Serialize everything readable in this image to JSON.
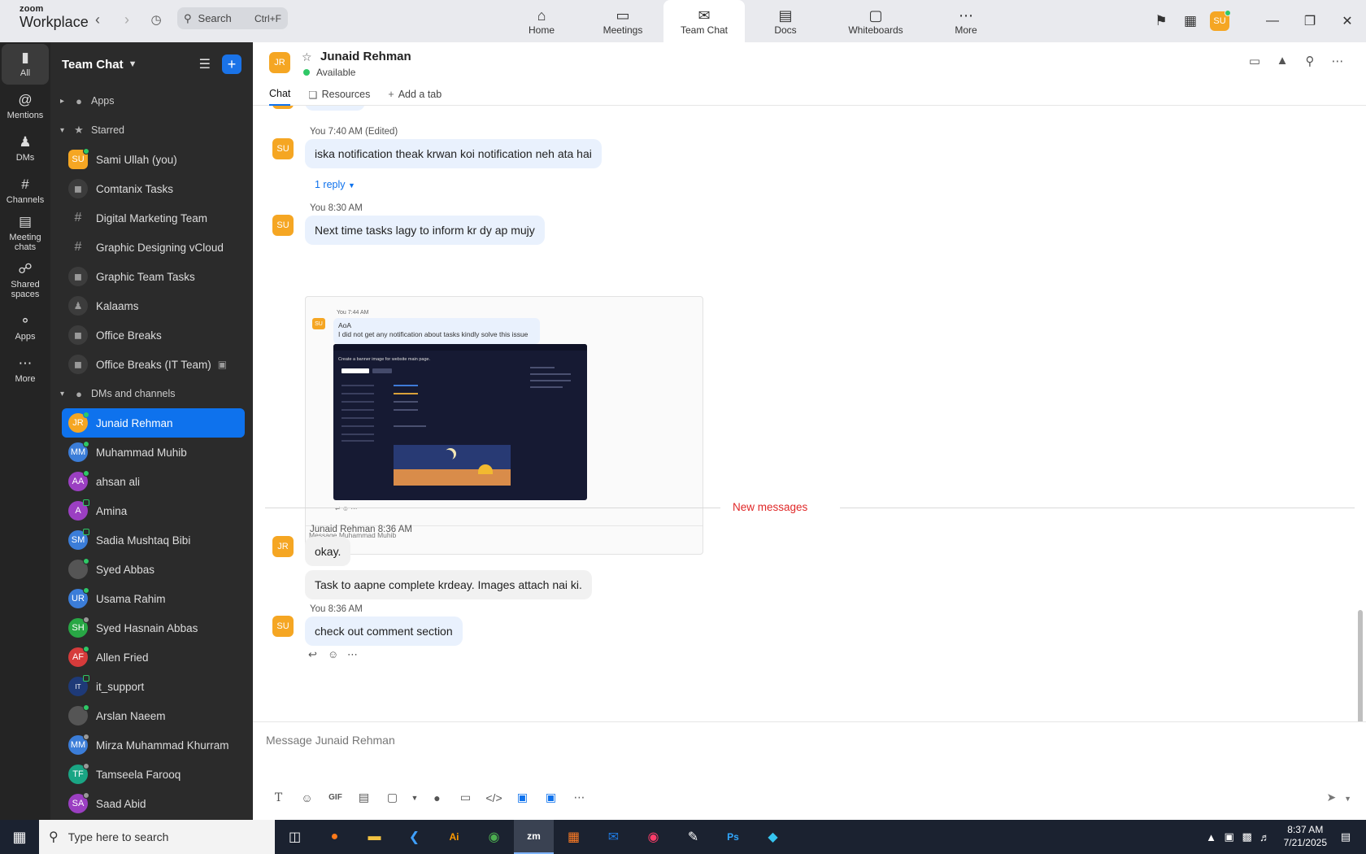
{
  "app": {
    "logo_small": "zoom",
    "logo_big": "Workplace",
    "search_placeholder": "Search",
    "search_shortcut": "Ctrl+F",
    "user_initials": "SU"
  },
  "top_nav": [
    {
      "label": "Home",
      "icon": "home-icon"
    },
    {
      "label": "Meetings",
      "icon": "video-icon"
    },
    {
      "label": "Team Chat",
      "icon": "chat-icon"
    },
    {
      "label": "Docs",
      "icon": "doc-icon"
    },
    {
      "label": "Whiteboards",
      "icon": "whiteboard-icon"
    },
    {
      "label": "More",
      "icon": "more-icon"
    }
  ],
  "rail": [
    {
      "label": "All",
      "icon": "chat-bubble-icon"
    },
    {
      "label": "Mentions",
      "icon": "at-icon"
    },
    {
      "label": "DMs",
      "icon": "people-icon"
    },
    {
      "label": "Channels",
      "icon": "hash-icon"
    },
    {
      "label": "Meeting chats",
      "icon": "calendar-icon"
    },
    {
      "label": "Shared spaces",
      "icon": "share-icon"
    },
    {
      "label": "Apps",
      "icon": "apps-icon"
    },
    {
      "label": "More",
      "icon": "ellipsis-icon"
    }
  ],
  "sidebar": {
    "title": "Team Chat",
    "sections": {
      "apps": "Apps",
      "starred": "Starred",
      "dms": "DMs and channels"
    },
    "starred": [
      {
        "label": "Sami Ullah (you)",
        "initials": "SU",
        "color": "#f5a623",
        "kind": "avatar"
      },
      {
        "label": "Comtanix Tasks",
        "kind": "lock"
      },
      {
        "label": "Digital Marketing Team",
        "kind": "hash"
      },
      {
        "label": "Graphic Designing vCloud",
        "kind": "hash"
      },
      {
        "label": "Graphic Team Tasks",
        "kind": "lock"
      },
      {
        "label": "Kalaams",
        "kind": "group"
      },
      {
        "label": "Office Breaks",
        "kind": "lock"
      },
      {
        "label": "Office Breaks (IT Team)",
        "kind": "lock"
      }
    ],
    "dms": [
      {
        "label": "Junaid Rehman",
        "initials": "JR",
        "color": "#f5a623"
      },
      {
        "label": "Muhammad Muhib",
        "initials": "MM",
        "color": "#3b7dd8"
      },
      {
        "label": "ahsan ali",
        "initials": "AA",
        "color": "#9b3fc2"
      },
      {
        "label": "Amina",
        "initials": "A",
        "color": "#9b3fc2"
      },
      {
        "label": "Sadia Mushtaq Bibi",
        "initials": "SM",
        "color": "#3b7dd8"
      },
      {
        "label": "Syed Abbas",
        "initials": "",
        "color": "#555555"
      },
      {
        "label": "Usama Rahim",
        "initials": "UR",
        "color": "#3b7dd8"
      },
      {
        "label": "Syed Hasnain Abbas",
        "initials": "SH",
        "color": "#28a745"
      },
      {
        "label": "Allen Fried",
        "initials": "AF",
        "color": "#d63b3b"
      },
      {
        "label": "it_support",
        "initials": "IT",
        "color": "#1e3a78"
      },
      {
        "label": "Arslan Naeem",
        "initials": "",
        "color": "#555555"
      },
      {
        "label": "Mirza Muhammad Khurram",
        "initials": "MM",
        "color": "#3b7dd8"
      },
      {
        "label": "Tamseela Farooq",
        "initials": "TF",
        "color": "#1aa584"
      },
      {
        "label": "Saad Abid",
        "initials": "SA",
        "color": "#9b3fc2"
      }
    ]
  },
  "chat": {
    "contact_initials": "JR",
    "contact_name": "Junaid Rehman",
    "status": "Available",
    "tabs": [
      "Chat",
      "Resources",
      "Add a tab"
    ],
    "messages": {
      "m1_meta": "You 7:40 AM (Edited)",
      "m1_text": "iska notification theak krwan koi notification neh ata hai",
      "m1_reply": "1 reply",
      "m2_meta": "You 8:30 AM",
      "m2_text": "Next time tasks lagy to inform kr dy ap mujy",
      "new_messages": "New messages",
      "m3_meta": "Junaid Rehman 8:36 AM",
      "m3_text": "okay.",
      "m4_text": "Task to aapne complete krdeay. Images attach nai ki.",
      "m5_meta": "You 8:36 AM",
      "m5_text": "check out comment section"
    },
    "embed": {
      "meta": "You 7:44 AM",
      "line1": "AoA",
      "line2": "I did not get any notification about tasks kindly solve this issue",
      "title": "Create a banner image for website main page.",
      "input_placeholder": "Message Muhammad Muhib"
    },
    "composer_placeholder": "Message Junaid Rehman",
    "composer_gif": "GIF"
  },
  "taskbar": {
    "search_placeholder": "Type here to search",
    "time": "8:37 AM",
    "date": "7/21/2025"
  }
}
